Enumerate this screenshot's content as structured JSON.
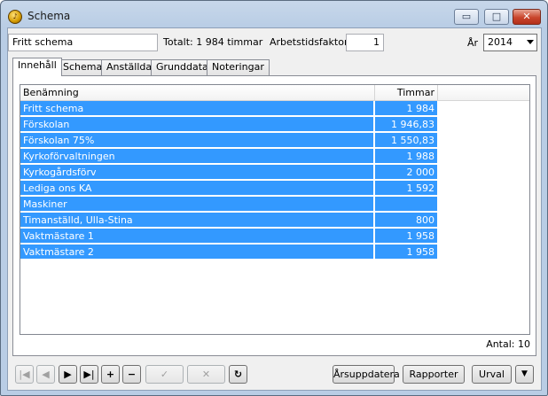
{
  "window": {
    "title": "Schema",
    "app_icon": "orchestra-icon",
    "min_symbol": "▭",
    "max_symbol": "□",
    "close_symbol": "✕"
  },
  "header": {
    "schedule_name": "Fritt schema",
    "total_label": "Totalt: 1 984 timmar",
    "factor_label": "Arbetstidsfaktor:",
    "factor_value": "1",
    "year_label": "År",
    "year_value": "2014"
  },
  "tabs": [
    {
      "label": "Innehåll",
      "active": true
    },
    {
      "label": "Schema",
      "active": false
    },
    {
      "label": "Anställda",
      "active": false
    },
    {
      "label": "Grunddata",
      "active": false
    },
    {
      "label": "Noteringar",
      "active": false
    }
  ],
  "table": {
    "columns": [
      "Benämning",
      "Timmar"
    ],
    "rows": [
      {
        "name": "Fritt schema",
        "hours": "1 984"
      },
      {
        "name": "Förskolan",
        "hours": "1 946,83"
      },
      {
        "name": "Förskolan 75%",
        "hours": "1 550,83"
      },
      {
        "name": "Kyrkoförvaltningen",
        "hours": "1 988"
      },
      {
        "name": "Kyrkogårdsförv",
        "hours": "2 000"
      },
      {
        "name": "Lediga ons KA",
        "hours": "1 592"
      },
      {
        "name": "Maskiner",
        "hours": ""
      },
      {
        "name": "Timanställd, Ulla-Stina",
        "hours": "800"
      },
      {
        "name": "Vaktmästare 1",
        "hours": "1 958"
      },
      {
        "name": "Vaktmästare 2",
        "hours": "1 958"
      }
    ],
    "selection_color": "#3399ff"
  },
  "footer": {
    "count_label": "Antal: 10",
    "nav": {
      "first": "|◀",
      "prev": "◀",
      "next": "▶",
      "last": "▶|",
      "add": "+",
      "remove": "−",
      "confirm": "✓",
      "cancel": "✕",
      "refresh": "↻"
    },
    "update_year_label": "Årsuppdatera",
    "reports_label": "Rapporter",
    "selection_label": "Urval",
    "more_symbol": "▼"
  }
}
